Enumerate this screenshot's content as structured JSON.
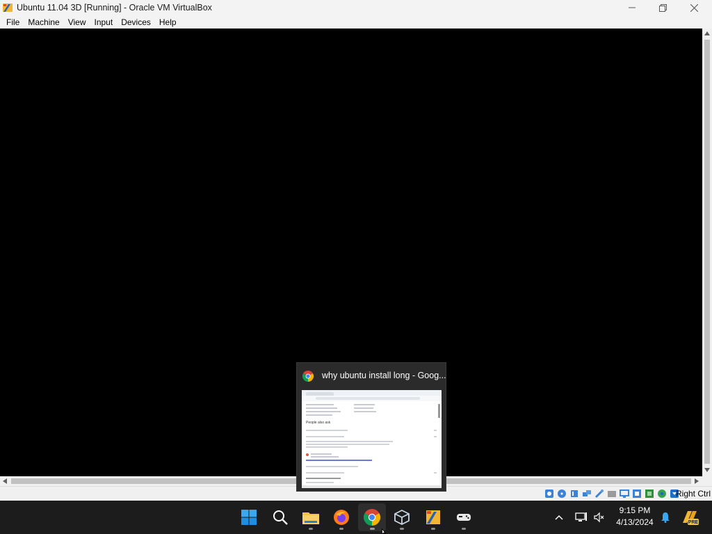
{
  "window": {
    "title": "Ubuntu 11.04 3D [Running] - Oracle VM VirtualBox"
  },
  "menu": {
    "items": [
      "File",
      "Machine",
      "View",
      "Input",
      "Devices",
      "Help"
    ]
  },
  "statusbar": {
    "host_key": "Right Ctrl"
  },
  "preview": {
    "title": "why ubuntu install long - Goog...",
    "thumb_heading": "People also ask"
  },
  "taskbar": {
    "apps": [
      "start",
      "search",
      "file-explorer",
      "firefox",
      "chrome",
      "virtualbox",
      "app-6",
      "app-7"
    ]
  },
  "clock": {
    "time": "9:15 PM",
    "date": "4/13/2024"
  },
  "tray": {
    "badge": "PRE"
  }
}
